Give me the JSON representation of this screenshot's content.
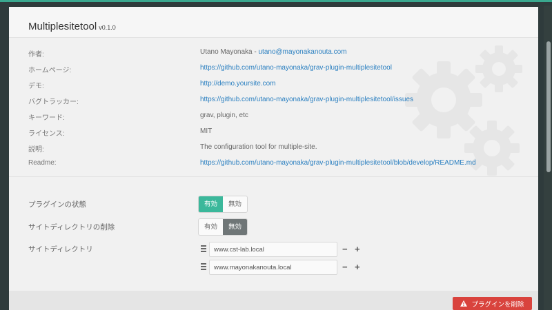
{
  "plugin": {
    "title": "Multiplesitetool",
    "version": "v0.1.0"
  },
  "info": [
    {
      "label": "作者:",
      "value": "Utano Mayonaka - ",
      "link": "utano@mayonakanouta.com"
    },
    {
      "label": "ホームページ:",
      "value": "",
      "link": "https://github.com/utano-mayonaka/grav-plugin-multiplesitetool"
    },
    {
      "label": "デモ:",
      "value": "",
      "link": "http://demo.yoursite.com"
    },
    {
      "label": "バグトラッカー:",
      "value": "",
      "link": "https://github.com/utano-mayonaka/grav-plugin-multiplesitetool/issues"
    },
    {
      "label": "キーワード:",
      "value": "grav, plugin, etc",
      "link": ""
    },
    {
      "label": "ライセンス:",
      "value": "MIT",
      "link": ""
    },
    {
      "label": "説明:",
      "value": "The configuration tool for multiple-site.",
      "link": ""
    },
    {
      "label": "Readme:",
      "value": "",
      "link": "https://github.com/utano-mayonaka/grav-plugin-multiplesitetool/blob/develop/README.md"
    }
  ],
  "config": {
    "plugin_state": {
      "label": "プラグインの状態",
      "on": "有効",
      "off": "無効",
      "selected": "on"
    },
    "delete_site_dir": {
      "label": "サイトディレクトリの削除",
      "on": "有効",
      "off": "無効",
      "selected": "off"
    },
    "site_directory": {
      "label": "サイトディレクトリ",
      "items": [
        "www.cst-lab.local",
        "www.mayonakanouta.local"
      ],
      "remove_symbol": "−",
      "add_symbol": "+"
    }
  },
  "footer": {
    "delete_button": "プラグインを削除"
  },
  "colors": {
    "accent": "#3bb89b",
    "danger": "#d9433d",
    "link": "#2a7fc0"
  }
}
